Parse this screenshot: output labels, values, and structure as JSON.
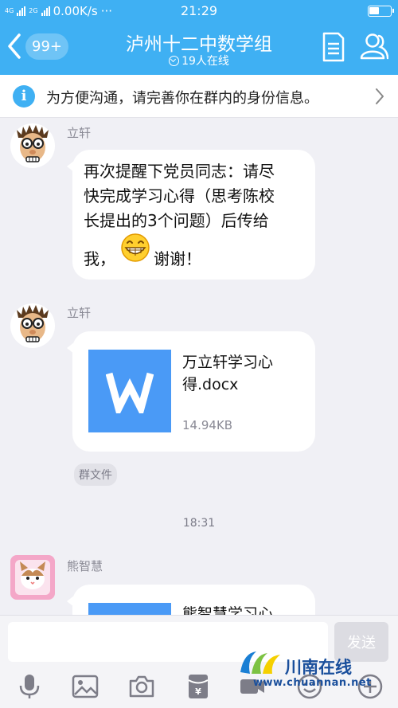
{
  "status_bar": {
    "network": "4G",
    "network2": "2G",
    "speed": "0.00K/s",
    "dots": "···",
    "time": "21:29"
  },
  "header": {
    "unread_badge": "99+",
    "group_name": "泸州十二中数学组",
    "online_status": "19人在线"
  },
  "notice": {
    "text": "为方便沟通，请完善你在群内的身份信息。"
  },
  "messages": [
    {
      "sender": "立轩",
      "lines": [
        "再次提醒下党员同志：请尽",
        "快完成学习心得（思考陈校",
        "长提出的3个问题）后传给"
      ],
      "line_before_emoji": "我，",
      "line_after_emoji": "谢谢！"
    },
    {
      "sender": "立轩",
      "file_name_line1": "万立轩学习心",
      "file_name_line2": "得.docx",
      "file_size": "14.94KB",
      "tag": "群文件"
    },
    {
      "sender": "熊智慧",
      "file_name_line1": "熊智慧学习心"
    }
  ],
  "timestamp": "18:31",
  "input": {
    "send_label": "发送"
  },
  "watermark": {
    "title": "川南在线",
    "url": "www.chuannan.net"
  },
  "colors": {
    "accent": "#3fb0f3",
    "file_icon": "#4a9af6",
    "background": "#f0f0f5"
  },
  "icons": [
    "back-icon",
    "document-icon",
    "profile-icon",
    "info-icon",
    "chevron-right-icon",
    "microphone-icon",
    "image-icon",
    "camera-icon",
    "red-packet-icon",
    "video-icon",
    "emoji-icon",
    "plus-icon",
    "word-file-icon"
  ]
}
